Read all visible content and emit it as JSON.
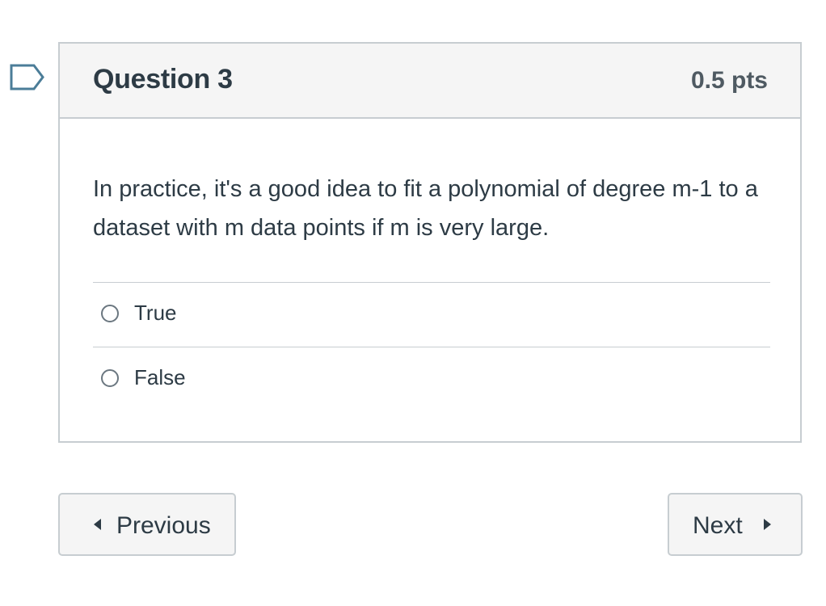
{
  "question": {
    "title": "Question 3",
    "points": "0.5 pts",
    "text": "In practice, it's a good idea to fit a polynomial of degree m-1 to a dataset with m data points if m is very large.",
    "answers": [
      {
        "label": "True",
        "selected": false
      },
      {
        "label": "False",
        "selected": false
      }
    ]
  },
  "navigation": {
    "previous_label": "Previous",
    "next_label": "Next"
  },
  "icons": {
    "flag": "flag-question-icon",
    "previous_arrow": "caret-left-icon",
    "next_arrow": "caret-right-icon",
    "radio": "radio-unchecked-icon"
  },
  "colors": {
    "text": "#2d3b45",
    "border": "#c7cdd1",
    "header_background": "#f5f5f5",
    "flag_outline": "#4b7d98"
  }
}
